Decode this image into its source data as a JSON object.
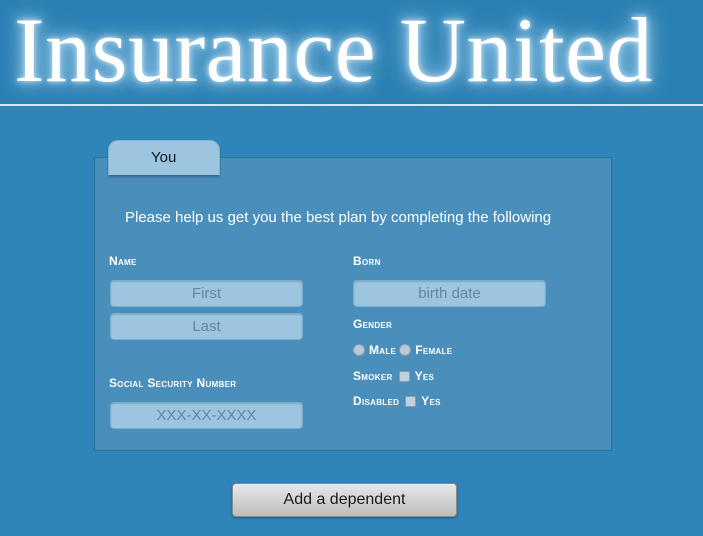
{
  "header": {
    "title": "Insurance United"
  },
  "tabs": [
    {
      "label": "You",
      "active": true
    }
  ],
  "form": {
    "intro": "Please help us get you the best plan by completing the following",
    "name": {
      "label": "Name",
      "first_placeholder": "First",
      "last_placeholder": "Last"
    },
    "ssn": {
      "label": "Social Security Number",
      "placeholder": "XXX-XX-XXXX"
    },
    "born": {
      "label": "Born",
      "placeholder": "birth date"
    },
    "gender": {
      "label": "Gender",
      "options": [
        "Male",
        "Female"
      ]
    },
    "smoker": {
      "label": "Smoker",
      "option": "Yes"
    },
    "disabled": {
      "label": "Disabled",
      "option": "Yes"
    }
  },
  "actions": {
    "add_dependent_label": "Add a dependent"
  },
  "colors": {
    "background": "#2f85b9",
    "panel": "#4a8ebc",
    "input": "#9cc5df"
  }
}
